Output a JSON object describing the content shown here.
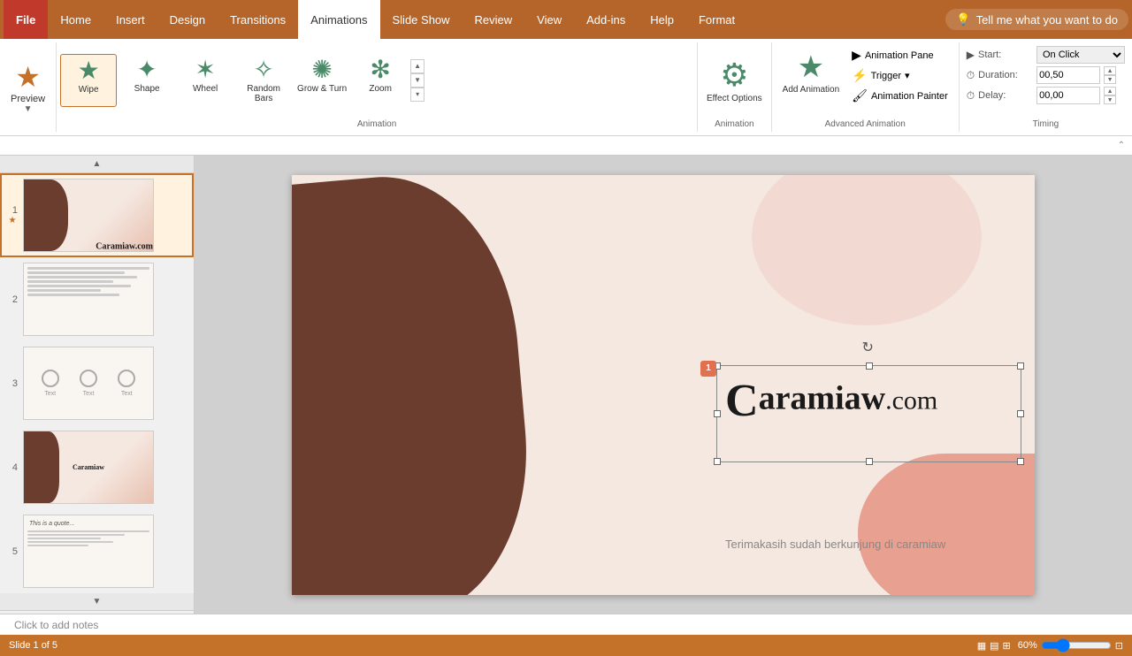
{
  "tabs": {
    "file": "File",
    "home": "Home",
    "insert": "Insert",
    "design": "Design",
    "transitions": "Transitions",
    "animations": "Animations",
    "slideshow": "Slide Show",
    "review": "Review",
    "view": "View",
    "addins": "Add-ins",
    "help": "Help",
    "format": "Format"
  },
  "tellme": {
    "placeholder": "Tell me what you want to do"
  },
  "preview": {
    "label": "Preview",
    "sublabel": ""
  },
  "animations": [
    {
      "id": "wipe",
      "label": "Wipe",
      "selected": true
    },
    {
      "id": "shape",
      "label": "Shape",
      "selected": false
    },
    {
      "id": "wheel",
      "label": "Wheel",
      "selected": false
    },
    {
      "id": "random_bars",
      "label": "Random Bars",
      "selected": false
    },
    {
      "id": "grow_turn",
      "label": "Grow & Turn",
      "selected": false
    },
    {
      "id": "zoom",
      "label": "Zoom",
      "selected": false
    }
  ],
  "animation_group_label": "Animation",
  "effect_options": {
    "label": "Effect Options",
    "group": "Animation"
  },
  "advanced_animation": {
    "group_label": "Advanced Animation",
    "animation_pane": "Animation Pane",
    "trigger": "Trigger",
    "add_animation": "Add\nAnimation",
    "animation_painter": "Animation Painter"
  },
  "timing": {
    "group_label": "Timing",
    "start_label": "Start:",
    "start_value": "On Click",
    "duration_label": "Duration:",
    "duration_value": "00,50",
    "delay_label": "Delay:",
    "delay_value": "00,00"
  },
  "slides": [
    {
      "number": "1",
      "selected": true,
      "has_star": true
    },
    {
      "number": "2",
      "selected": false,
      "has_star": false
    },
    {
      "number": "3",
      "selected": false,
      "has_star": false
    },
    {
      "number": "4",
      "selected": false,
      "has_star": false
    },
    {
      "number": "5",
      "selected": false,
      "has_star": false
    }
  ],
  "canvas": {
    "brand_text": "Caramiaw.com",
    "sub_text": "Terimakasih sudah berkunjung di caramiaw",
    "anim_badge": "1"
  },
  "notes": {
    "placeholder": "Click to add notes"
  },
  "colors": {
    "accent": "#c4722a",
    "tab_active_bg": "white",
    "tab_active_text": "#333"
  }
}
